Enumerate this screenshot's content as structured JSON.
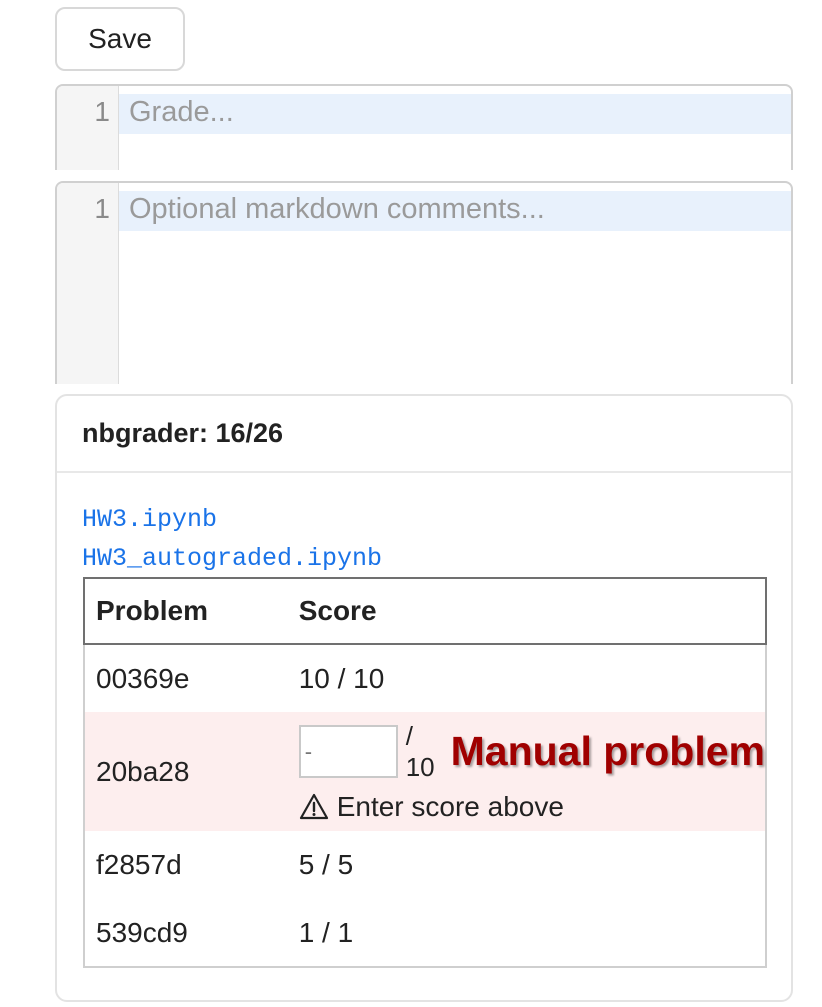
{
  "toolbar": {
    "save_label": "Save"
  },
  "grade_editor": {
    "line_number": "1",
    "placeholder": "Grade..."
  },
  "comments_editor": {
    "line_number": "1",
    "placeholder": "Optional markdown comments..."
  },
  "panel": {
    "title": "nbgrader: 16/26",
    "links": [
      "HW3.ipynb",
      "HW3_autograded.ipynb"
    ],
    "table": {
      "headers": [
        "Problem",
        "Score"
      ],
      "rows": [
        {
          "problem": "00369e",
          "score": "10 / 10"
        },
        {
          "problem": "20ba28",
          "input_placeholder": "-",
          "max": "/ 10",
          "badge": "Manual problem",
          "warning_icon": "warning-triangle-icon",
          "warning": "Enter score above"
        },
        {
          "problem": "f2857d",
          "score": "5 / 5"
        },
        {
          "problem": "539cd9",
          "score": "1 / 1"
        }
      ]
    }
  },
  "colors": {
    "link": "#1a73e8",
    "manual_row_bg": "#fdeeee",
    "manual_label": "#a00000",
    "active_line": "#e8f1fc"
  }
}
